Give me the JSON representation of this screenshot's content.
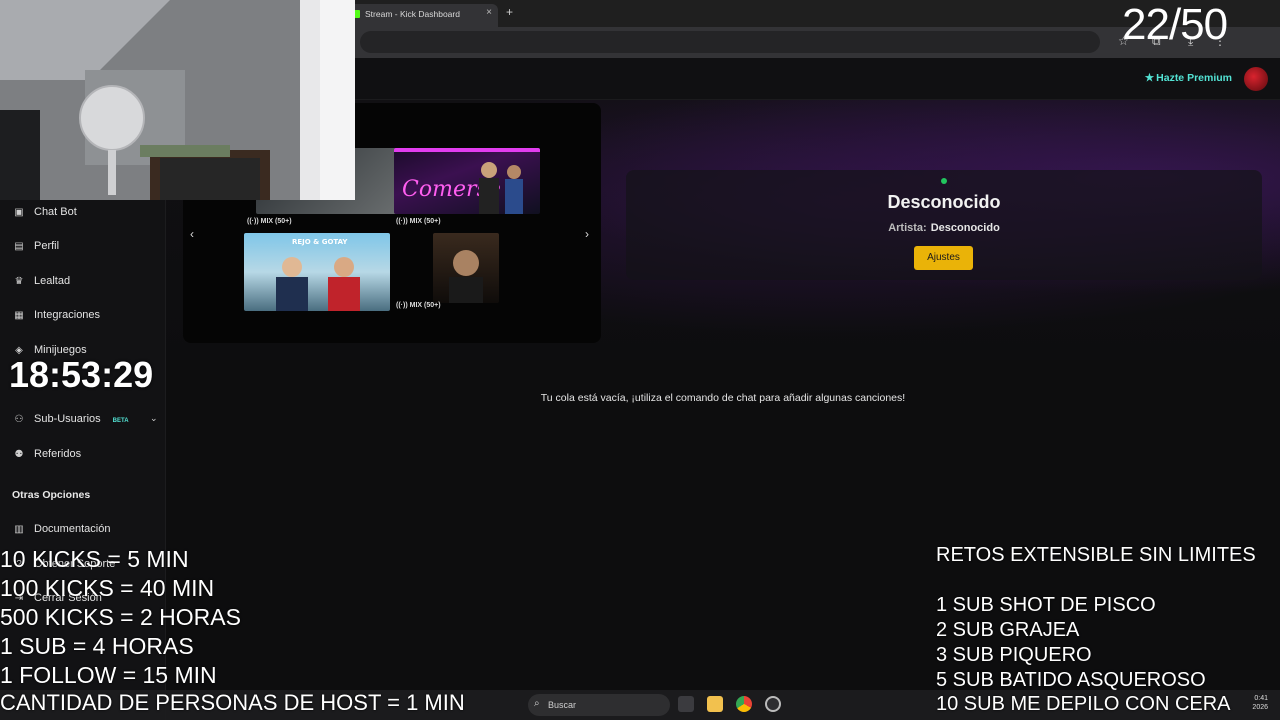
{
  "browser": {
    "tab_title": "Stream - Kick Dashboard",
    "tab_close": "×",
    "new_tab": "+"
  },
  "topnav": {
    "premium_label": "Hazte Premium"
  },
  "sidebar": {
    "items": [
      {
        "label": "Chat Bot",
        "icon": "robot-icon"
      },
      {
        "label": "Perfil",
        "icon": "id-card-icon"
      },
      {
        "label": "Lealtad",
        "icon": "trophy-icon"
      },
      {
        "label": "Integraciones",
        "icon": "integration-icon"
      },
      {
        "label": "Minijuegos",
        "icon": "gamepad-icon"
      },
      {
        "label": "Sub-Usuarios",
        "icon": "users-icon",
        "badge": "BETA"
      },
      {
        "label": "Referidos",
        "icon": "referrals-icon"
      }
    ],
    "section_other": "Otras Opciones",
    "other_items": [
      {
        "label": "Documentación",
        "icon": "docs-icon"
      },
      {
        "label": "Obtener Soporte",
        "icon": "help-icon"
      },
      {
        "label": "Cerrar Sesión",
        "icon": "logout-icon"
      }
    ]
  },
  "carousel": {
    "labels": [
      "MIX (50+)",
      "MIX (50+)",
      "MIX (50+)"
    ],
    "cover_text": [
      "REJO & GOTAY"
    ]
  },
  "now_playing": {
    "title": "Desconocido",
    "artist_label": "Artista:",
    "artist_value": "Desconocido",
    "settings_button": "Ajustes"
  },
  "queue": {
    "empty_message": "Tu cola está vacía, ¡utiliza el comando de chat para añadir algunas canciones!"
  },
  "overlay": {
    "counter": "22/50",
    "clock": "18:53:29",
    "rules": [
      "10 KICKS = 5 MIN",
      "100 KICKS = 40 MIN",
      "500 KICKS = 2 HORAS",
      "1 SUB = 4 HORAS",
      " 1 FOLLOW = 15 MIN",
      "CANTIDAD DE PERSONAS DE HOST = 1 MIN"
    ],
    "retos_title": "RETOS EXTENSIBLE SIN LIMITES",
    "retos": [
      "1 SUB SHOT DE PISCO",
      "2 SUB  GRAJEA",
      "3 SUB PIQUERO",
      "5 SUB BATIDO ASQUEROSO",
      "10 SUB ME DEPILO CON CERA"
    ]
  },
  "taskbar": {
    "search_placeholder": "Buscar",
    "time": "0:41",
    "date": "2026"
  },
  "colors": {
    "accent_teal": "#53e3d4",
    "button_yellow": "#eab308",
    "kick_green": "#53fc18",
    "live_green": "#22c55e"
  }
}
